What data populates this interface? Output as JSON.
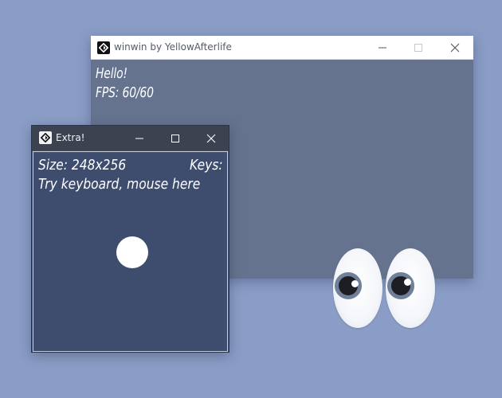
{
  "colors": {
    "desktop": "#8a9dc6",
    "main_client": "#65738f",
    "extra_client": "#3e4d6e",
    "extra_titlebar": "#3d4250"
  },
  "main_window": {
    "title": "winwin by YellowAfterlife",
    "icon": "app-logo-icon",
    "hello": "Hello!",
    "fps": "FPS: 60/60"
  },
  "extra_window": {
    "title": "Extra!",
    "icon": "app-logo-icon",
    "size": "Size: 248x256",
    "keys": "Keys:",
    "hint": "Try keyboard, mouse here"
  },
  "eyes": {
    "icon": "googly-eyes-icon"
  }
}
